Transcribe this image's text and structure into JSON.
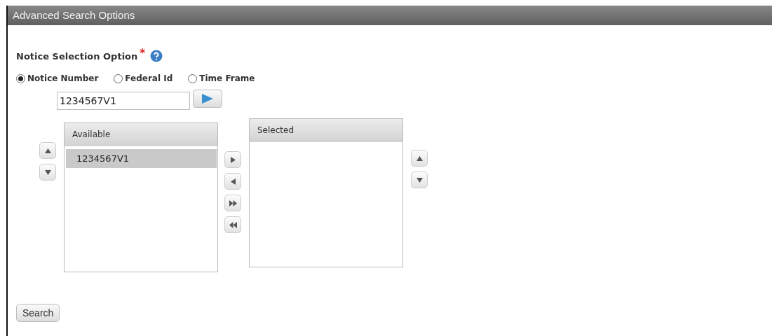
{
  "panel": {
    "title": "Advanced Search Options"
  },
  "field_label": {
    "text": "Notice Selection Option",
    "required_mark": "*"
  },
  "options": [
    {
      "label": "Notice Number",
      "selected": true
    },
    {
      "label": "Federal Id",
      "selected": false
    },
    {
      "label": "Time Frame",
      "selected": false
    }
  ],
  "notice_input": {
    "value": "1234567V1"
  },
  "available": {
    "heading": "Available",
    "items": [
      {
        "label": "1234567V1",
        "selected": true
      }
    ]
  },
  "selected_list": {
    "heading": "Selected"
  },
  "search_button": "Search"
}
